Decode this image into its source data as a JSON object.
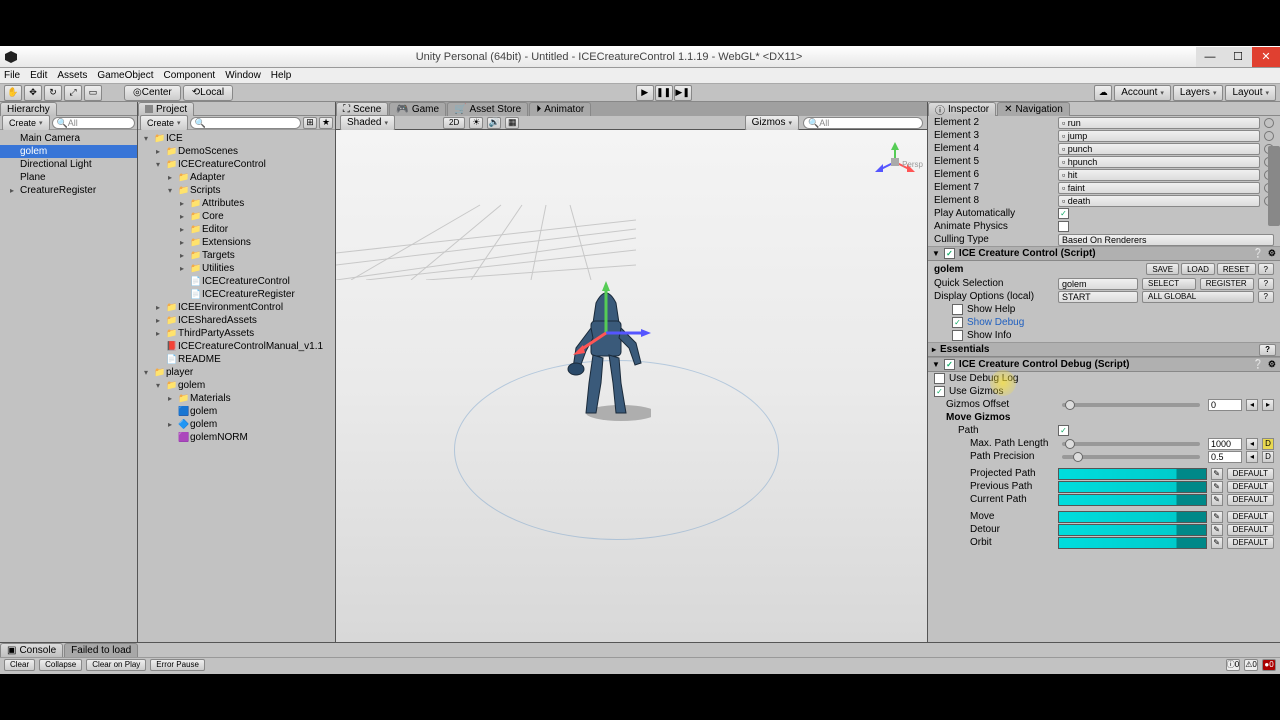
{
  "window": {
    "title": "Unity Personal (64bit) - Untitled - ICECreatureControl 1.1.19 - WebGL* <DX11>"
  },
  "menu": [
    "File",
    "Edit",
    "Assets",
    "GameObject",
    "Component",
    "Window",
    "Help"
  ],
  "toolbar": {
    "center": "Center",
    "local": "Local",
    "account": "Account",
    "layers": "Layers",
    "layout": "Layout"
  },
  "hierarchy": {
    "title": "Hierarchy",
    "create": "Create",
    "search_ph": "All",
    "items": [
      {
        "label": "Main Camera",
        "indent": 10
      },
      {
        "label": "golem",
        "indent": 10,
        "sel": true
      },
      {
        "label": "Directional Light",
        "indent": 10
      },
      {
        "label": "Plane",
        "indent": 10
      },
      {
        "label": "CreatureRegister",
        "indent": 10,
        "arrow": "▸"
      }
    ]
  },
  "project": {
    "title": "Project",
    "create": "Create",
    "items": [
      {
        "label": "ICE",
        "indent": 6,
        "arrow": "▾",
        "icon": "folder"
      },
      {
        "label": "DemoScenes",
        "indent": 18,
        "arrow": "▸",
        "icon": "folder"
      },
      {
        "label": "ICECreatureControl",
        "indent": 18,
        "arrow": "▾",
        "icon": "folder"
      },
      {
        "label": "Adapter",
        "indent": 30,
        "arrow": "▸",
        "icon": "folder"
      },
      {
        "label": "Scripts",
        "indent": 30,
        "arrow": "▾",
        "icon": "folder"
      },
      {
        "label": "Attributes",
        "indent": 42,
        "arrow": "▸",
        "icon": "folder"
      },
      {
        "label": "Core",
        "indent": 42,
        "arrow": "▸",
        "icon": "folder"
      },
      {
        "label": "Editor",
        "indent": 42,
        "arrow": "▸",
        "icon": "folder"
      },
      {
        "label": "Extensions",
        "indent": 42,
        "arrow": "▸",
        "icon": "folder"
      },
      {
        "label": "Targets",
        "indent": 42,
        "arrow": "▸",
        "icon": "folder"
      },
      {
        "label": "Utilities",
        "indent": 42,
        "arrow": "▸",
        "icon": "folder"
      },
      {
        "label": "ICECreatureControl",
        "indent": 42,
        "icon": "cs"
      },
      {
        "label": "ICECreatureRegister",
        "indent": 42,
        "icon": "cs"
      },
      {
        "label": "ICEEnvironmentControl",
        "indent": 18,
        "arrow": "▸",
        "icon": "folder"
      },
      {
        "label": "ICESharedAssets",
        "indent": 18,
        "arrow": "▸",
        "icon": "folder"
      },
      {
        "label": "ThirdPartyAssets",
        "indent": 18,
        "arrow": "▸",
        "icon": "folder"
      },
      {
        "label": "ICECreatureControlManual_v1.1",
        "indent": 18,
        "icon": "pdf"
      },
      {
        "label": "README",
        "indent": 18,
        "icon": "txt"
      },
      {
        "label": "player",
        "indent": 6,
        "arrow": "▾",
        "icon": "folder"
      },
      {
        "label": "golem",
        "indent": 18,
        "arrow": "▾",
        "icon": "folder"
      },
      {
        "label": "Materials",
        "indent": 30,
        "arrow": "▸",
        "icon": "folder"
      },
      {
        "label": "golem",
        "indent": 30,
        "icon": "prefab"
      },
      {
        "label": "golem",
        "indent": 30,
        "arrow": "▸",
        "icon": "mesh"
      },
      {
        "label": "golemNORM",
        "indent": 30,
        "icon": "img"
      }
    ]
  },
  "scene": {
    "tabs": [
      "Scene",
      "Game",
      "Asset Store",
      "Animator"
    ],
    "shaded": "Shaded",
    "twod": "2D",
    "gizmos": "Gizmos",
    "search_ph": "All",
    "persp": "Persp"
  },
  "inspector": {
    "tabs": [
      "Inspector",
      "Navigation"
    ],
    "elements": [
      {
        "name": "Element 2",
        "val": "run"
      },
      {
        "name": "Element 3",
        "val": "jump"
      },
      {
        "name": "Element 4",
        "val": "punch"
      },
      {
        "name": "Element 5",
        "val": "hpunch"
      },
      {
        "name": "Element 6",
        "val": "hit"
      },
      {
        "name": "Element 7",
        "val": "faint"
      },
      {
        "name": "Element 8",
        "val": "death"
      }
    ],
    "play_auto": "Play Automatically",
    "anim_phys": "Animate Physics",
    "culling": {
      "label": "Culling Type",
      "val": "Based On Renderers"
    },
    "icc": {
      "title": "ICE Creature Control (Script)",
      "name": "golem",
      "save": "SAVE",
      "load": "LOAD",
      "reset": "RESET",
      "quick_sel": {
        "label": "Quick Selection",
        "val": "golem",
        "select": "SELECT",
        "register": "REGISTER"
      },
      "disp_opt": {
        "label": "Display Options (local)",
        "val": "START",
        "all": "ALL GLOBAL"
      },
      "show_help": "Show Help",
      "show_debug": "Show Debug",
      "show_info": "Show Info"
    },
    "essentials": "Essentials",
    "debug": {
      "title": "ICE Creature Control Debug (Script)",
      "use_log": "Use Debug Log",
      "use_gizmos": "Use Gizmos",
      "offset": {
        "label": "Gizmos Offset",
        "val": "0"
      },
      "move_gizmos": "Move Gizmos",
      "path": "Path",
      "max_path": {
        "label": "Max. Path Length",
        "val": "1000"
      },
      "precision": {
        "label": "Path Precision",
        "val": "0.5"
      },
      "projected": "Projected Path",
      "previous": "Previous Path",
      "current": "Current Path",
      "move": "Move",
      "detour": "Detour",
      "orbit": "Orbit",
      "default": "DEFAULT",
      "d": "D"
    }
  },
  "console": {
    "tab": "Console",
    "failed": "Failed to load",
    "clear": "Clear",
    "collapse": "Collapse",
    "cop": "Clear on Play",
    "ep": "Error Pause",
    "c_info": "0",
    "c_warn": "0",
    "c_err": "0"
  }
}
